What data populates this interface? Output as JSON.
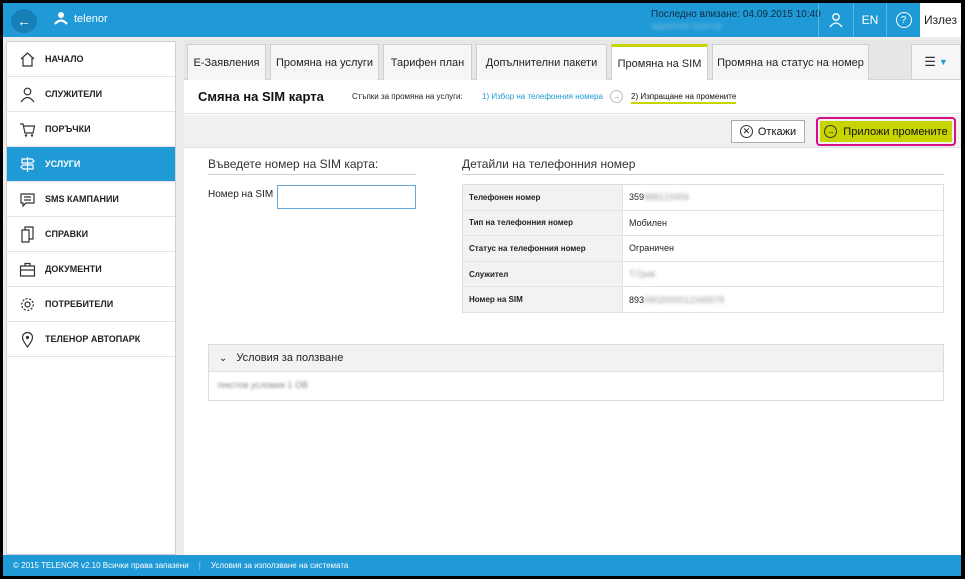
{
  "header": {
    "brand": "telenor",
    "last_login_label": "Последно влизане: 04.09.2015 10:40",
    "last_login_user": "администратор",
    "lang": "EN",
    "help": "?",
    "exit": "Излез"
  },
  "sidebar": {
    "items": [
      {
        "label": "НАЧАЛО",
        "icon": "home-icon"
      },
      {
        "label": "СЛУЖИТЕЛИ",
        "icon": "user-icon"
      },
      {
        "label": "ПОРЪЧКИ",
        "icon": "cart-icon"
      },
      {
        "label": "УСЛУГИ",
        "icon": "signpost-icon",
        "active": true
      },
      {
        "label": "SMS КАМПАНИИ",
        "icon": "message-icon"
      },
      {
        "label": "СПРАВКИ",
        "icon": "documents-icon"
      },
      {
        "label": "ДОКУМЕНТИ",
        "icon": "briefcase-icon"
      },
      {
        "label": "ПОТРЕБИТЕЛИ",
        "icon": "gear-icon"
      },
      {
        "label": "ТЕЛЕНОР АВТОПАРК",
        "icon": "location-pin-icon"
      }
    ]
  },
  "tabs": [
    {
      "label": "Е-Заявления"
    },
    {
      "label": "Промяна на услуги"
    },
    {
      "label": "Тарифен план"
    },
    {
      "label": "Допълнителни пакети"
    },
    {
      "label": "Промяна на SIM",
      "active": true
    },
    {
      "label": "Промяна на статус на номер"
    }
  ],
  "page": {
    "title": "Смяна на SIM карта",
    "steps_label": "Стъпки за промяна на услуги:",
    "step1": "1) Избор на телефонния номера",
    "step2": "2) Изпращане на промените"
  },
  "actions": {
    "cancel": "Откажи",
    "apply": "Приложи промените"
  },
  "sim_form": {
    "heading": "Въведете номер на SIM карта:",
    "label": "Номер на SIM",
    "value": "",
    "placeholder": ""
  },
  "details": {
    "heading": "Детайли на телефонния номер",
    "rows": [
      {
        "key": "Телефонен номер",
        "value": "359",
        "hidden": "888123456"
      },
      {
        "key": "Тип на телефонния номер",
        "value": "Мобилен",
        "hidden": ""
      },
      {
        "key": "Статус на телефонния номер",
        "value": "Ограничен",
        "hidden": ""
      },
      {
        "key": "Служител",
        "value": "",
        "hidden": "Т.Грив"
      },
      {
        "key": "Номер на SIM",
        "value": "893",
        "hidden": "5902000012345678"
      }
    ]
  },
  "terms": {
    "title": "Условия за ползване",
    "body": "текстов условия 1 ОВ"
  },
  "footer": {
    "copyright": "© 2015 TELENOR v2.10 Всички права запазени",
    "terms_link": "Условия за използване на системата"
  },
  "colors": {
    "brand_blue": "#1f9ad6",
    "accent_green": "#c8d400",
    "highlight_pink": "#d60f86"
  }
}
